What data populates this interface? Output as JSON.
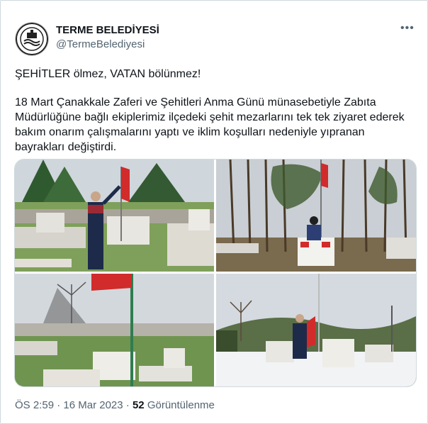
{
  "account": {
    "name": "TERME BELEDİYESİ",
    "handle": "@TermeBelediyesi",
    "avatar_icon": "municipality-seal-icon"
  },
  "menu_icon": "more-options-icon",
  "tweet": {
    "line1": "ŞEHİTLER ölmez, VATAN bölünmez!",
    "line2": "18 Mart Çanakkale Zaferi ve Şehitleri Anma Günü münasebetiyle Zabıta Müdürlüğüne bağlı ekiplerimiz ilçedeki şehit mezarlarını tek tek ziyaret ederek bakım onarım çalışmalarını yaptı ve iklim koşulları nedeniyle yıpranan bayrakları değiştirdi."
  },
  "photos": [
    "cemetery-photo-1",
    "cemetery-photo-2",
    "cemetery-photo-3",
    "cemetery-photo-4"
  ],
  "meta": {
    "time": "ÖS 2:59",
    "separator": " · ",
    "date": "16 Mar 2023",
    "sep2": " · ",
    "views_count": "52",
    "views_label": " Görüntülenme"
  },
  "colors": {
    "flag_red": "#d12b2b",
    "uniform_navy": "#1e2a4a",
    "grass": "#5f8a3a",
    "sky": "#d9dee4"
  }
}
